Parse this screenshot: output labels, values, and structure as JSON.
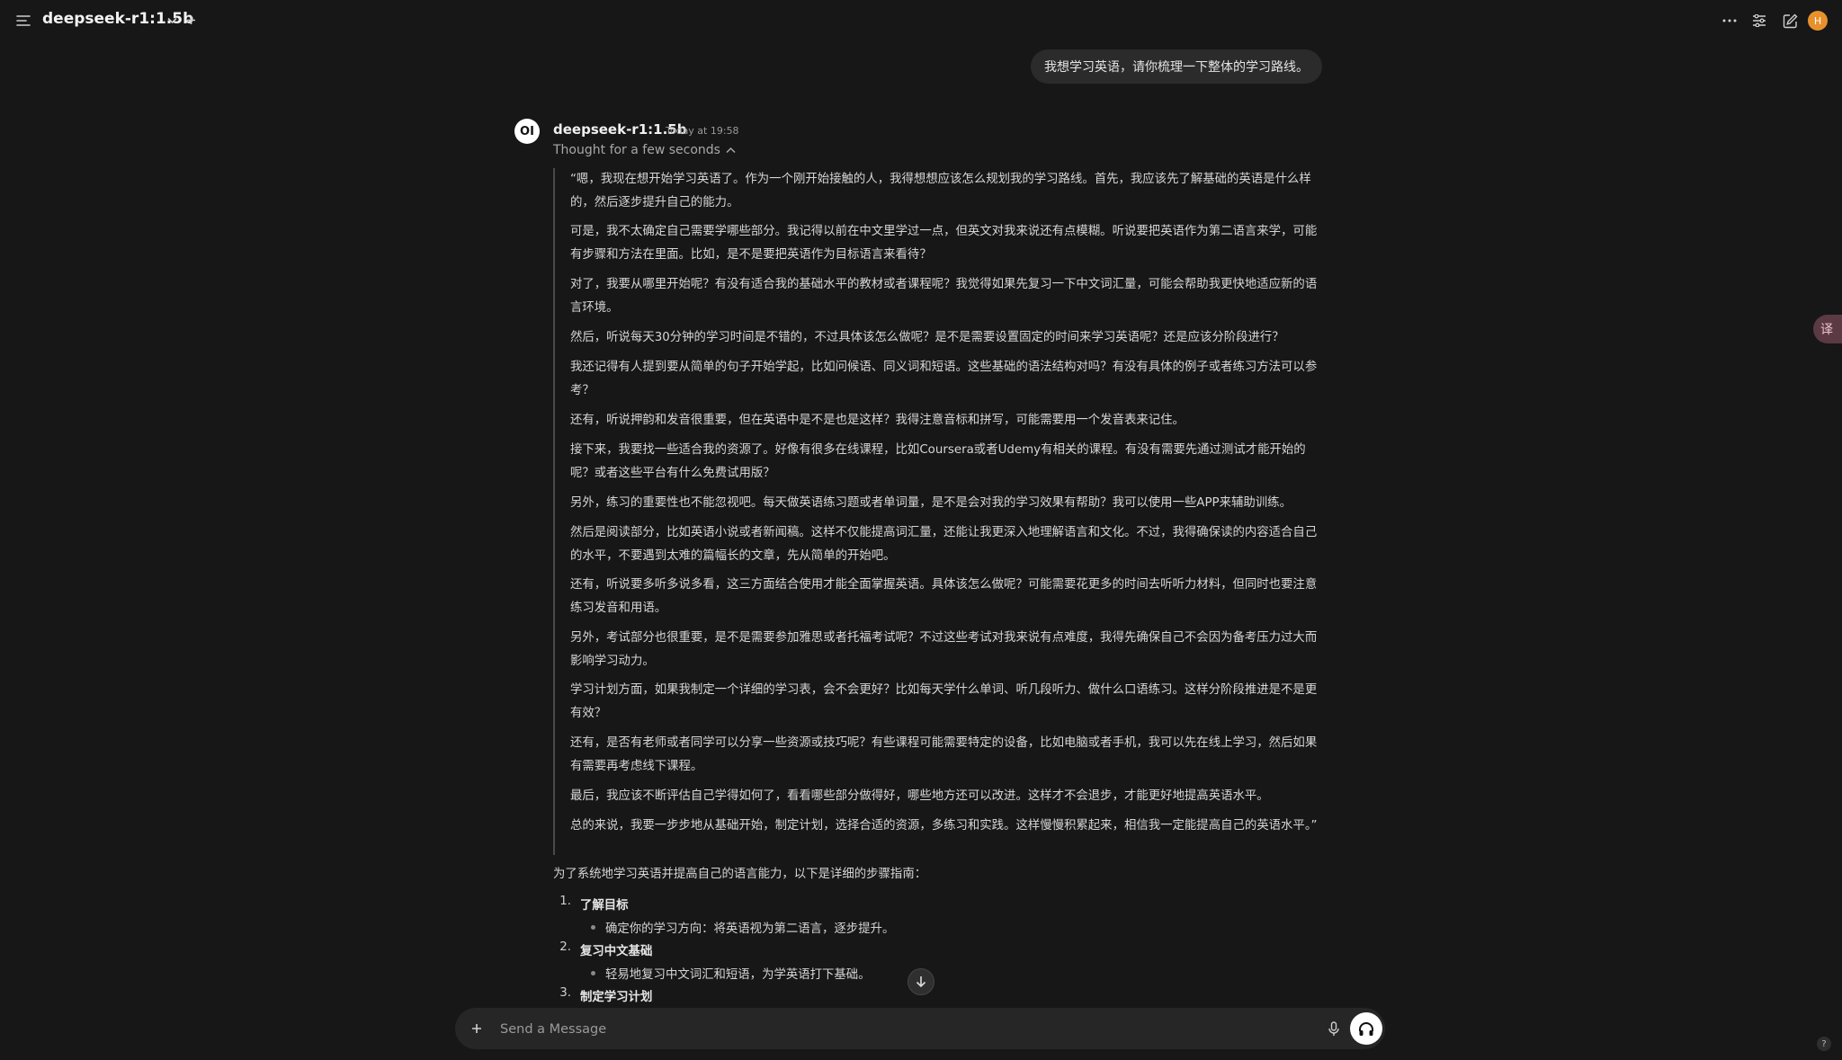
{
  "header": {
    "model_name": "deepseek-r1:1.5b",
    "avatar_initial": "H"
  },
  "user_message": "我想学习英语，请你梳理一下整体的学习路线。",
  "assistant": {
    "avatar_text": "OI",
    "name": "deepseek-r1:1.5b",
    "timestamp": "Today at 19:58",
    "thought_label": "Thought for a few seconds",
    "thinking": [
      "“嗯，我现在想开始学习英语了。作为一个刚开始接触的人，我得想想应该怎么规划我的学习路线。首先，我应该先了解基础的英语是什么样的，然后逐步提升自己的能力。",
      "可是，我不太确定自己需要学哪些部分。我记得以前在中文里学过一点，但英文对我来说还有点模糊。听说要把英语作为第二语言来学，可能有步骤和方法在里面。比如，是不是要把英语作为目标语言来看待？",
      "对了，我要从哪里开始呢？有没有适合我的基础水平的教材或者课程呢？我觉得如果先复习一下中文词汇量，可能会帮助我更快地适应新的语言环境。",
      "然后，听说每天30分钟的学习时间是不错的，不过具体该怎么做呢？是不是需要设置固定的时间来学习英语呢？还是应该分阶段进行？",
      "我还记得有人提到要从简单的句子开始学起，比如问候语、同义词和短语。这些基础的语法结构对吗？有没有具体的例子或者练习方法可以参考？",
      "还有，听说押韵和发音很重要，但在英语中是不是也是这样？我得注意音标和拼写，可能需要用一个发音表来记住。",
      "接下来，我要找一些适合我的资源了。好像有很多在线课程，比如Coursera或者Udemy有相关的课程。有没有需要先通过测试才能开始的呢？或者这些平台有什么免费试用版？",
      "另外，练习的重要性也不能忽视吧。每天做英语练习题或者单词量，是不是会对我的学习效果有帮助？我可以使用一些APP来辅助训练。",
      "然后是阅读部分，比如英语小说或者新闻稿。这样不仅能提高词汇量，还能让我更深入地理解语言和文化。不过，我得确保读的内容适合自己的水平，不要遇到太难的篇幅长的文章，先从简单的开始吧。",
      "还有，听说要多听多说多看，这三方面结合使用才能全面掌握英语。具体该怎么做呢？可能需要花更多的时间去听听力材料，但同时也要注意练习发音和用语。",
      "另外，考试部分也很重要，是不是需要参加雅思或者托福考试呢？不过这些考试对我来说有点难度，我得先确保自己不会因为备考压力过大而影响学习动力。",
      "学习计划方面，如果我制定一个详细的学习表，会不会更好？比如每天学什么单词、听几段听力、做什么口语练习。这样分阶段推进是不是更有效？",
      "还有，是否有老师或者同学可以分享一些资源或技巧呢？有些课程可能需要特定的设备，比如电脑或者手机，我可以先在线上学习，然后如果有需要再考虑线下课程。",
      "最后，我应该不断评估自己学得如何了，看看哪些部分做得好，哪些地方还可以改进。这样才不会退步，才能更好地提高英语水平。",
      "总的来说，我要一步步地从基础开始，制定计划，选择合适的资源，多练习和实践。这样慢慢积累起来，相信我一定能提高自己的英语水平。”"
    ],
    "answer_intro": "为了系统地学习英语并提高自己的语言能力，以下是详细的步骤指南：",
    "steps": [
      {
        "num": "1.",
        "title": "了解目标",
        "bullet": "确定你的学习方向：将英语视为第二语言，逐步提升。"
      },
      {
        "num": "2.",
        "title": "复习中文基础",
        "bullet": "轻易地复习中文词汇和短语，为学英语打下基础。"
      },
      {
        "num": "3.",
        "title": "制定学习计划",
        "bullet": ""
      }
    ]
  },
  "composer": {
    "placeholder": "Send a Message"
  },
  "side_tab": "译",
  "help_label": "?"
}
